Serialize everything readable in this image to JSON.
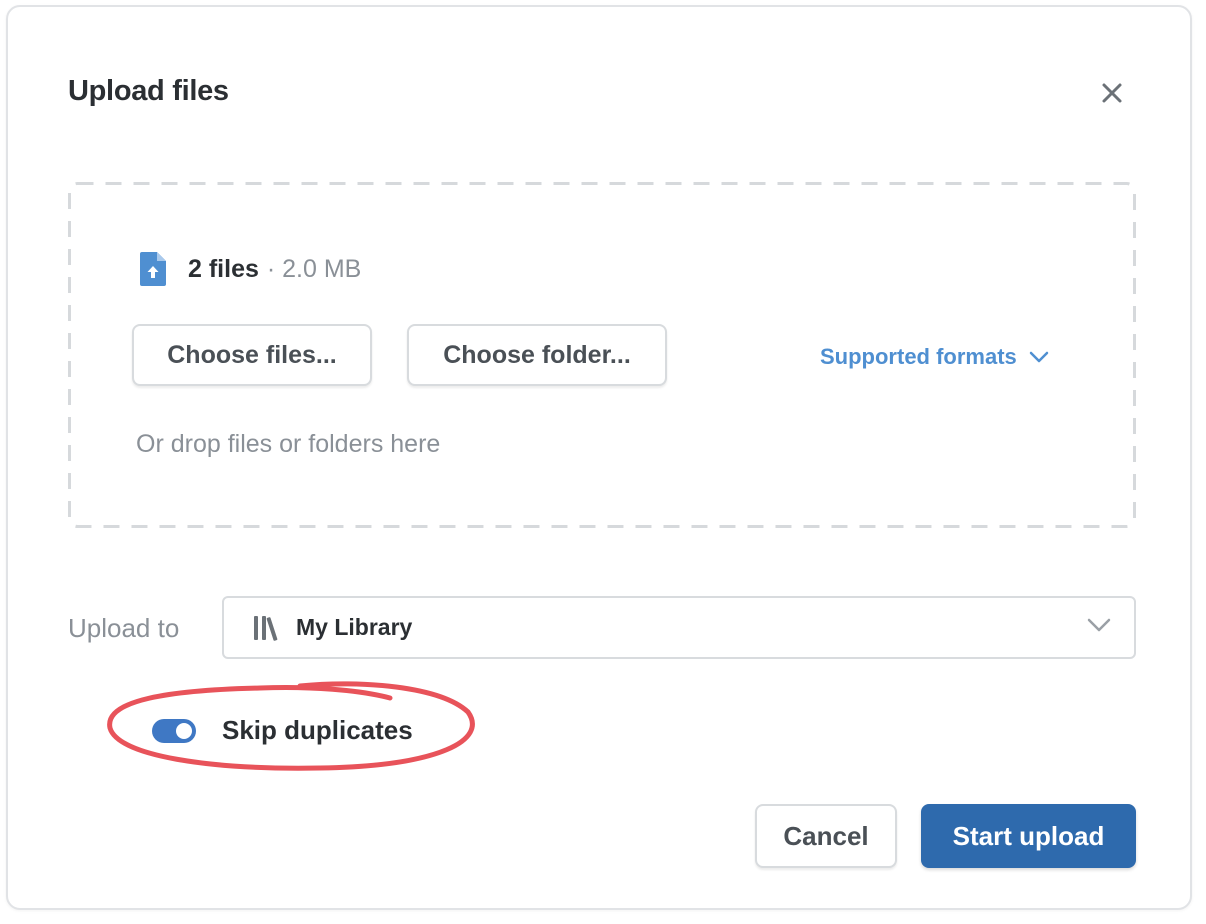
{
  "dialog": {
    "title": "Upload files",
    "close_icon": "close-icon"
  },
  "dropzone": {
    "file_icon": "file-upload-icon",
    "file_count": "2 files",
    "file_size": "· 2.0 MB",
    "choose_files_label": "Choose files...",
    "choose_folder_label": "Choose folder...",
    "supported_formats_label": "Supported formats",
    "drop_hint": "Or drop files or folders here"
  },
  "destination": {
    "label": "Upload to",
    "library_icon": "library-icon",
    "selected": "My Library"
  },
  "options": {
    "skip_duplicates_label": "Skip duplicates",
    "skip_duplicates_on": true
  },
  "footer": {
    "cancel_label": "Cancel",
    "start_label": "Start upload"
  },
  "colors": {
    "accent": "#2e6aad",
    "link": "#4f8fd1",
    "toggle": "#3f78c4",
    "annotation": "#e8535a"
  }
}
